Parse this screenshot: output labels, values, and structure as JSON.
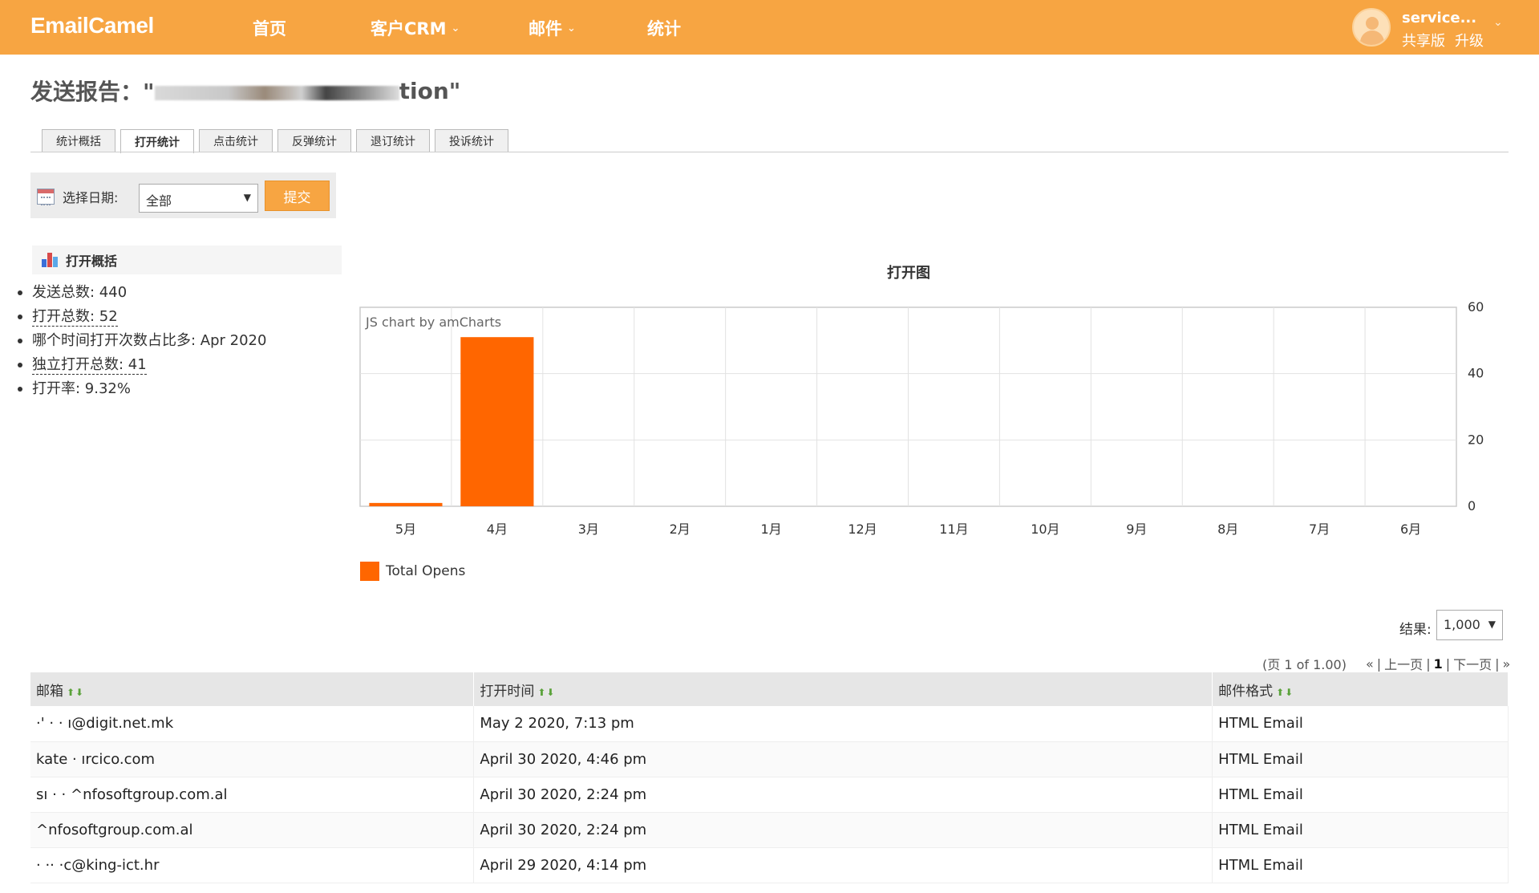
{
  "app": {
    "logo": "EmailCamel",
    "nav": [
      {
        "label": "首页",
        "has_dropdown": false
      },
      {
        "label": "客户CRM",
        "has_dropdown": true
      },
      {
        "label": "邮件",
        "has_dropdown": true
      },
      {
        "label": "统计",
        "has_dropdown": false
      }
    ],
    "user": {
      "name": "service...",
      "plan": "共享版",
      "upgrade": "升级"
    }
  },
  "page": {
    "title_prefix": "发送报告：\"",
    "title_suffix": "tion\""
  },
  "tabs": [
    {
      "label": "统计概括",
      "active": false
    },
    {
      "label": "打开统计",
      "active": true
    },
    {
      "label": "点击统计",
      "active": false
    },
    {
      "label": "反弹统计",
      "active": false
    },
    {
      "label": "退订统计",
      "active": false
    },
    {
      "label": "投诉统计",
      "active": false
    }
  ],
  "filter": {
    "label": "选择日期:",
    "selected": "全部",
    "submit": "提交"
  },
  "summary": {
    "heading": "打开概括",
    "items": [
      {
        "text": "发送总数: 440",
        "link": false
      },
      {
        "text": "打开总数: 52",
        "link": true
      },
      {
        "text": "哪个时间打开次数占比多: Apr 2020",
        "link": false
      },
      {
        "text": "独立打开总数: 41",
        "link": true
      },
      {
        "text": "打开率: 9.32%",
        "link": false
      }
    ]
  },
  "chart_data": {
    "type": "bar",
    "title": "打开图",
    "credit": "JS chart by amCharts",
    "categories": [
      "5月",
      "4月",
      "3月",
      "2月",
      "1月",
      "12月",
      "11月",
      "10月",
      "9月",
      "8月",
      "7月",
      "6月"
    ],
    "series": [
      {
        "name": "Total Opens",
        "color": "#ff6600",
        "values": [
          1,
          51,
          0,
          0,
          0,
          0,
          0,
          0,
          0,
          0,
          0,
          0
        ]
      }
    ],
    "ylim": [
      0,
      60
    ],
    "yticks": [
      "60",
      "40",
      "20",
      "0"
    ],
    "y_axis_side": "right",
    "grid": true,
    "legend": "bottom-left"
  },
  "results": {
    "label": "结果:",
    "selected": "1,000"
  },
  "pager": {
    "info": "(页 1 of 1.00)",
    "first": "«",
    "prev": "上一页",
    "current": "1",
    "next": "下一页",
    "last": "»"
  },
  "table": {
    "headers": [
      "邮箱",
      "打开时间",
      "邮件格式"
    ],
    "rows": [
      {
        "email": "·'     ·    ·     ı@digit.net.mk",
        "time": "May 2 2020, 7:13 pm",
        "format": "HTML Email"
      },
      {
        "email": "kate     ·    ırcico.com",
        "time": "April 30 2020, 4:46 pm",
        "format": "HTML Email"
      },
      {
        "email": "sı       ·  ·  ^nfosoftgroup.com.al",
        "time": "April 30 2020, 2:24 pm",
        "format": "HTML Email"
      },
      {
        "email": "           ^nfosoftgroup.com.al",
        "time": "April 30 2020, 2:24 pm",
        "format": "HTML Email"
      },
      {
        "email": "       ·   ·· ·c@king-ict.hr",
        "time": "April 29 2020, 4:14 pm",
        "format": "HTML Email"
      }
    ]
  }
}
